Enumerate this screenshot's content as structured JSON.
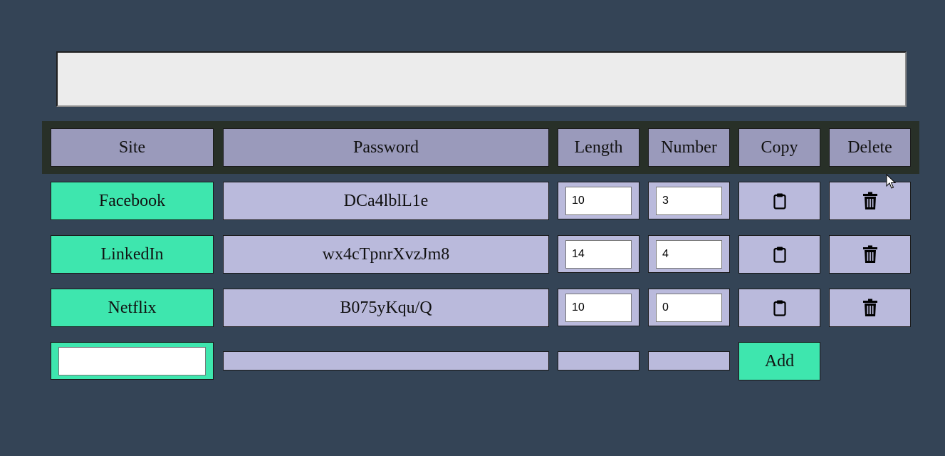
{
  "header": {
    "site": "Site",
    "password": "Password",
    "length": "Length",
    "number": "Number",
    "copy": "Copy",
    "delete": "Delete"
  },
  "rows": [
    {
      "site": "Facebook",
      "password": "DCa4lblL1e",
      "length": "10",
      "number": "3"
    },
    {
      "site": "LinkedIn",
      "password": "wx4cTpnrXvzJm8",
      "length": "14",
      "number": "4"
    },
    {
      "site": "Netflix",
      "password": "B075yKqu/Q",
      "length": "10",
      "number": "0"
    }
  ],
  "new_entry": {
    "site_value": "",
    "add_label": "Add"
  },
  "icons": {
    "copy": "clipboard-icon",
    "delete": "trash-icon"
  },
  "colors": {
    "background": "#344456",
    "header_cell": "#9a9abb",
    "site_cell": "#3ee6ae",
    "data_cell": "#babadc",
    "header_bar": "#283028"
  }
}
